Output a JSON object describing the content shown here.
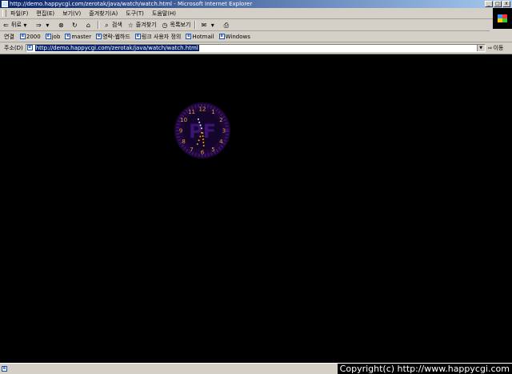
{
  "window": {
    "title": "http://demo.happycgi.com/zerotak/java/watch/watch.html - Microsoft Internet Explorer",
    "buttons": {
      "minimize": "_",
      "maximize": "□",
      "close": "x"
    }
  },
  "menu": [
    "파일(F)",
    "편집(E)",
    "보기(V)",
    "즐겨찾기(A)",
    "도구(T)",
    "도움말(H)"
  ],
  "toolbar": {
    "back": "뒤로",
    "search": "검색",
    "favorites": "즐겨찾기",
    "history": "목록보기"
  },
  "links": {
    "label": "연결",
    "items": [
      "2000",
      "job",
      "master",
      "영락-웹하드",
      "링크 사용자 정의",
      "Hotmail",
      "Windows"
    ]
  },
  "address": {
    "label": "주소(D)",
    "url": "http://demo.happycgi.com/zerotak/java/watch/watch.html",
    "go": "이동"
  },
  "clock": {
    "numbers": [
      "1",
      "2",
      "3",
      "4",
      "5",
      "6",
      "7",
      "8",
      "9",
      "10",
      "11",
      "12"
    ],
    "logo": "PF",
    "colors": {
      "ring": "#2a0b4a",
      "numerals": "#e0a040",
      "logo": "#3a1470",
      "dots": "#ffa000"
    }
  },
  "status": {
    "copyright": "Copyright(c) http://www.happycgi.com"
  }
}
